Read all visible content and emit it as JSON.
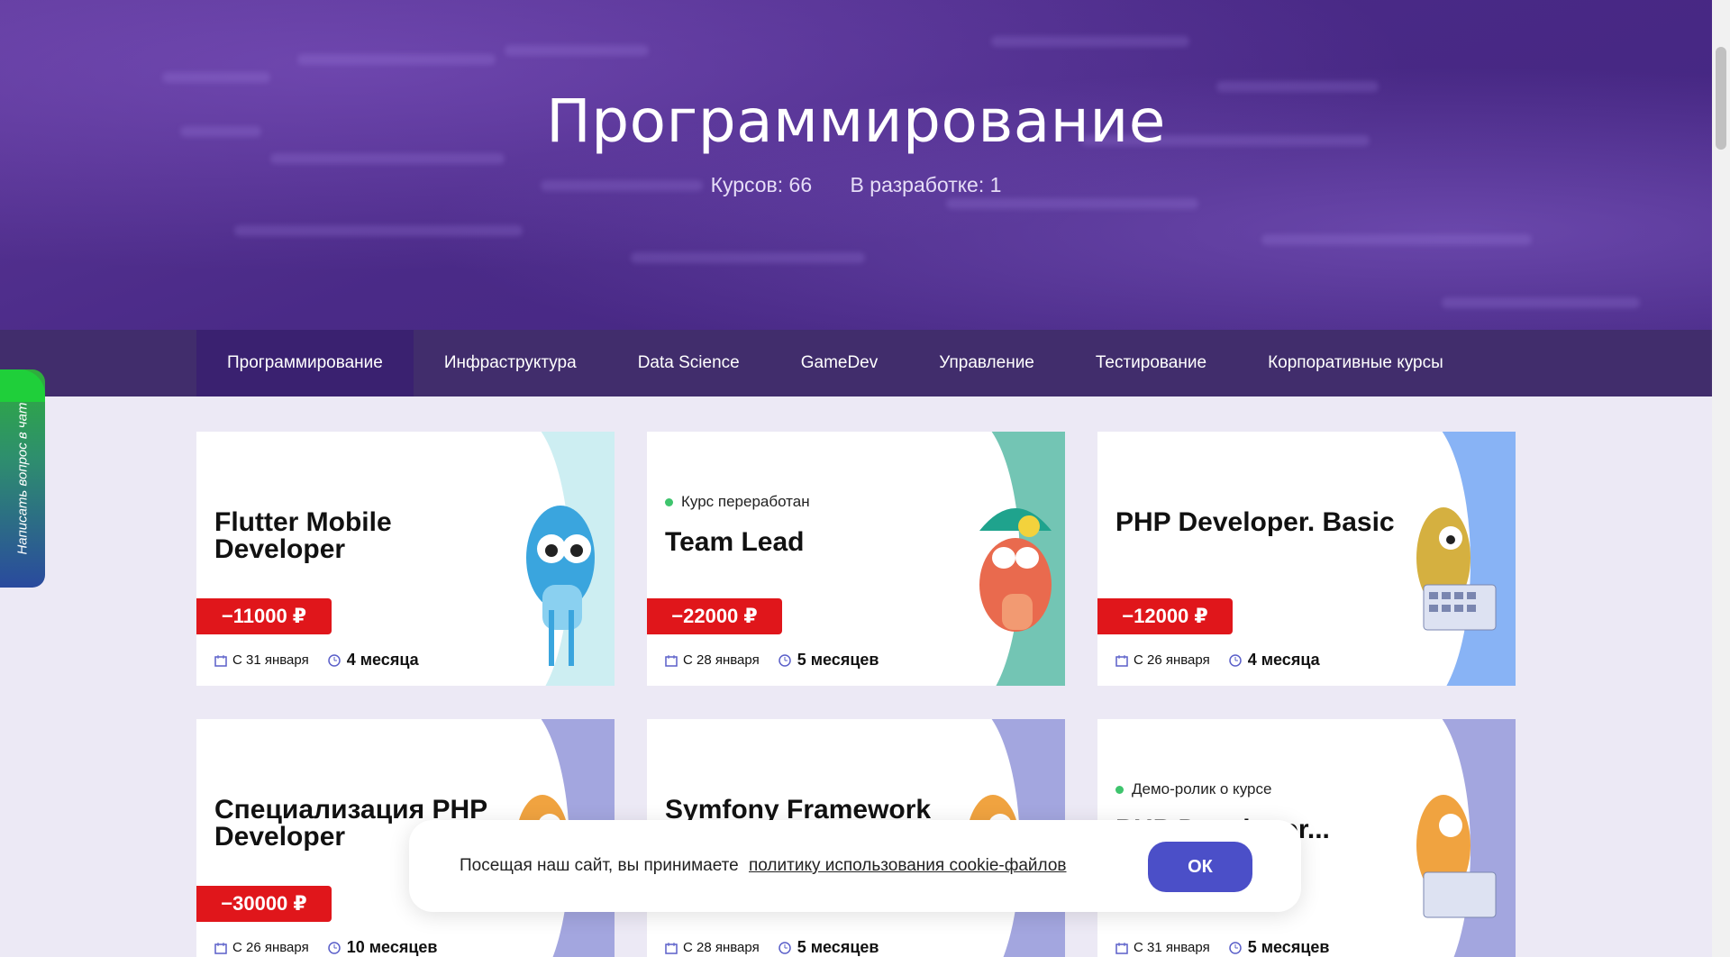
{
  "hero": {
    "title": "Программирование",
    "courses_label": "Курсов: 66",
    "dev_label": "В разработке: 1"
  },
  "nav": {
    "items": [
      "Программирование",
      "Инфраструктура",
      "Data Science",
      "GameDev",
      "Управление",
      "Тестирование",
      "Корпоративные курсы"
    ],
    "active": "Программирование"
  },
  "chat_tab": {
    "label": "Написать вопрос в чат"
  },
  "cards": [
    {
      "title": "Flutter Mobile Developer",
      "badge": "",
      "price": "−11000 ₽",
      "date": "С 31 января",
      "duration": "4 месяца",
      "art_color": "#cdeef2"
    },
    {
      "title": "Team Lead",
      "badge": "Курс переработан",
      "price": "−22000 ₽",
      "date": "С 28 января",
      "duration": "5 месяцев",
      "art_color": "#73c5b4"
    },
    {
      "title": "PHP Developer. Basic",
      "badge": "",
      "price": "−12000 ₽",
      "date": "С 26 января",
      "duration": "4 месяца",
      "art_color": "#88b3f5"
    },
    {
      "title": "Специализация PHP Developer",
      "badge": "",
      "price": "−30000 ₽",
      "date": "С 26 января",
      "duration": "10 месяцев",
      "art_color": "#a3a6df"
    },
    {
      "title": "Symfony Framework",
      "badge": "",
      "price": "",
      "date": "С 28 января",
      "duration": "5 месяцев",
      "art_color": "#a3a6df"
    },
    {
      "title": "PHP Developer...",
      "badge": "Демо-ролик о курсе",
      "price": "",
      "date": "С 31 января",
      "duration": "5 месяцев",
      "art_color": "#a3a6df"
    }
  ],
  "cookie": {
    "text": "Посещая наш сайт, вы принимаете",
    "link": "политику использования cookie-файлов",
    "ok": "ОК"
  },
  "colors": {
    "accent": "#4b4fc8",
    "price": "#e0161b",
    "badge_dot": "#3ec46d",
    "nav_bg": "#321c5f"
  }
}
